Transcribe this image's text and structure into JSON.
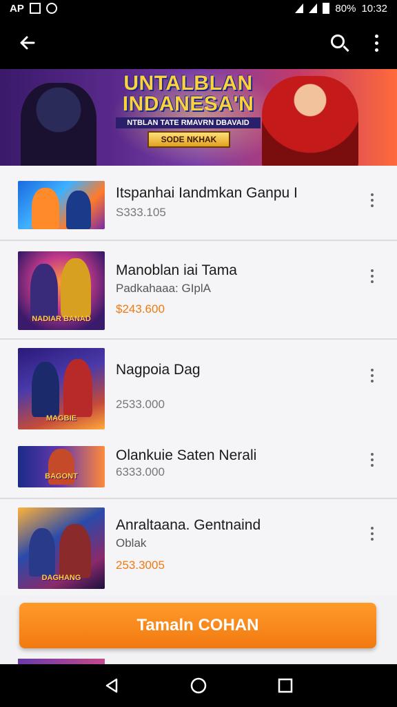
{
  "status_bar": {
    "left_text": "AP",
    "battery": "80%",
    "time": "10:32"
  },
  "app_bar": {
    "back_icon": "arrow-left-icon",
    "search_icon": "search-icon",
    "menu_icon": "more-vertical-icon"
  },
  "banner": {
    "title": "UNTALBLAN INDANESA'N",
    "subtitle": "NTBLAN TATE RMAVRN DBAVAID",
    "button": "SODE NKHAK"
  },
  "items": [
    {
      "title": "Itspanhai Iandmkan Ganpu I",
      "subtitle": "",
      "price": "S333.105",
      "price_style": "grey",
      "thumb_label": ""
    },
    {
      "title": "Manoblan iai Tama",
      "subtitle": "Padkahaaa: GIplA",
      "price": "$243.600",
      "price_style": "orange",
      "thumb_label": "NADIAR BANAD"
    },
    {
      "title": "Nagpoia Dag",
      "subtitle": "",
      "price": "2533.000",
      "price_style": "grey",
      "thumb_label": "MAGBIE"
    },
    {
      "title": "Olankuie Saten Nerali",
      "subtitle": "",
      "price": "6333.000",
      "price_style": "grey",
      "thumb_label": "BAGONT"
    },
    {
      "title": "Anraltaana. Gentnaind",
      "subtitle": "Oblak",
      "price": "253.3005",
      "price_style": "orange",
      "thumb_label": "DAGHANG"
    }
  ],
  "cta": {
    "label": "Tamaln COHAN"
  },
  "colors": {
    "accent": "#f27a10",
    "price_orange": "#f07a12",
    "list_bg": "#f2f1f3"
  },
  "nav": {
    "back": "nav-back-icon",
    "home": "nav-home-icon",
    "recents": "nav-recents-icon"
  }
}
